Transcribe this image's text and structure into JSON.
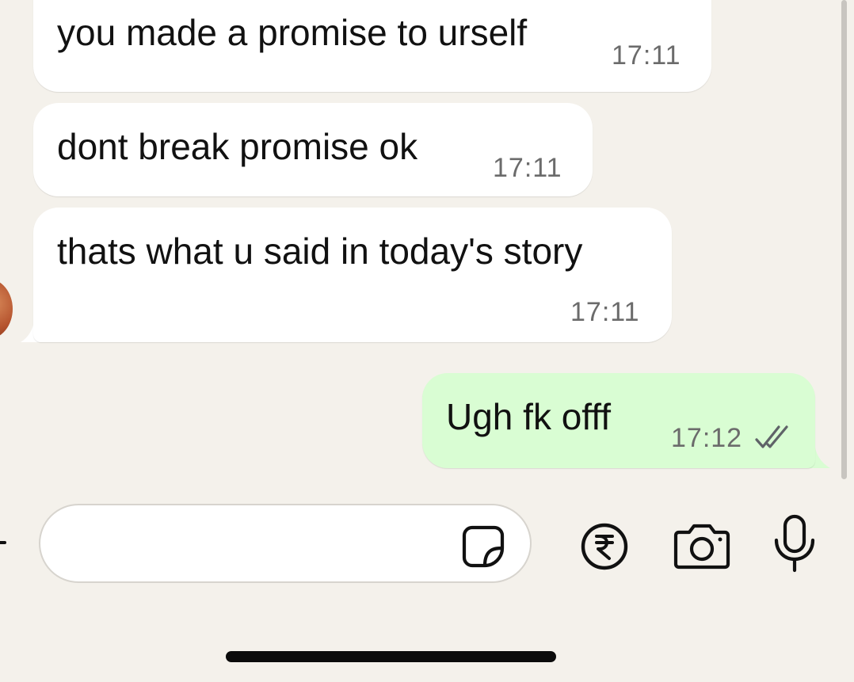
{
  "messages": [
    {
      "direction": "incoming",
      "text": "you made a promise to urself",
      "time": "17:11"
    },
    {
      "direction": "incoming",
      "text": "dont break promise ok",
      "time": "17:11"
    },
    {
      "direction": "incoming",
      "text": "thats what u said in today's story",
      "time": "17:11"
    },
    {
      "direction": "outgoing",
      "text": "Ugh fk offf",
      "time": "17:12",
      "status_icon": "double-check-icon"
    }
  ],
  "composer": {
    "input_value": "",
    "icons": [
      "sticker-icon",
      "rupee-payment-icon",
      "camera-icon",
      "microphone-icon"
    ]
  },
  "colors": {
    "background": "#f4f1eb",
    "incoming_bubble": "#ffffff",
    "outgoing_bubble": "#d9fdd3",
    "timestamp": "#6b6b6b"
  }
}
